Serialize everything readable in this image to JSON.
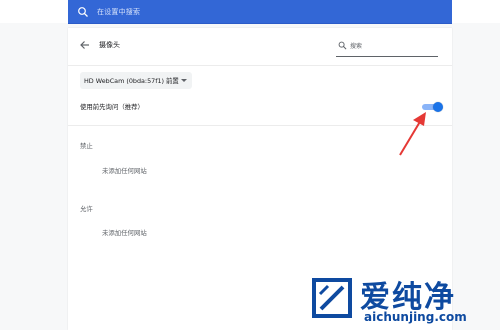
{
  "search": {
    "placeholder": "在设置中搜索"
  },
  "page": {
    "title": "摄像头",
    "site_search_placeholder": "搜索",
    "camera_select_value": "HD WebCam (0bda:57f1) 前置",
    "ask_before_access_label": "使用前先询问（推荐）",
    "ask_before_access_enabled": true,
    "blocked": {
      "label": "禁止",
      "empty": "未添加任何网站"
    },
    "allowed": {
      "label": "允许",
      "empty": "未添加任何网站"
    }
  },
  "watermark": {
    "name": "爱纯净",
    "url": "aichunjing.com"
  },
  "colors": {
    "accent": "#1a73e8",
    "topbar": "#3367d6",
    "annotation_arrow": "#e53935",
    "logo": "#0e4aa0"
  }
}
